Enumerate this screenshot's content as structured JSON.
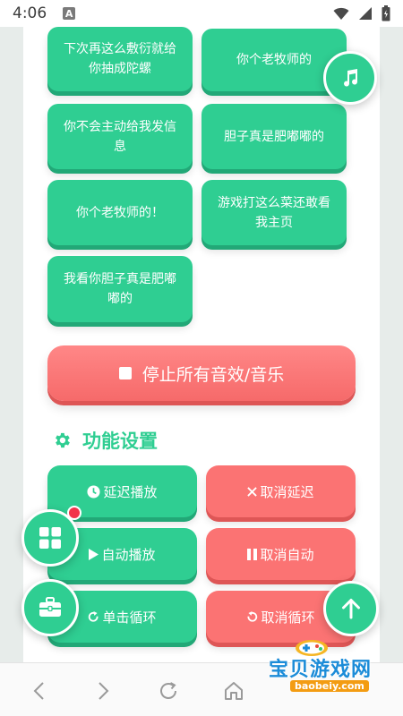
{
  "status_bar": {
    "time": "4:06",
    "sim_label": "A"
  },
  "sound_buttons": [
    {
      "label": "下次再这么敷衍就给你抽成陀螺"
    },
    {
      "label": "你个老牧师的"
    },
    {
      "label": "你不会主动给我发信息"
    },
    {
      "label": "胆子真是肥嘟嘟的"
    },
    {
      "label": "你个老牧师的！"
    },
    {
      "label": "游戏打这么菜还敢看我主页"
    },
    {
      "label": "我看你胆子真是肥嘟嘟的"
    }
  ],
  "stop_button": {
    "label": "停止所有音效/音乐"
  },
  "settings": {
    "title": "功能设置",
    "buttons": [
      {
        "label": "延迟播放",
        "icon": "clock-icon",
        "color": "#2fce92"
      },
      {
        "label": "取消延迟",
        "icon": "x-icon",
        "color": "#fb7373"
      },
      {
        "label": "自动播放",
        "icon": "play-icon",
        "color": "#2fce92"
      },
      {
        "label": "取消自动",
        "icon": "pause-icon",
        "color": "#fb7373"
      },
      {
        "label": "单击循环",
        "icon": "redo-icon",
        "color": "#2fce92"
      },
      {
        "label": "取消循环",
        "icon": "undo-icon",
        "color": "#fb7373"
      }
    ]
  },
  "floating": {
    "music_icon": "music-note-icon",
    "grid_icon": "grid-icon",
    "toolbox_icon": "toolbox-icon",
    "top_icon": "arrow-up-icon"
  },
  "watermark": {
    "title": "宝贝游戏网",
    "url": "baobeiy.com"
  },
  "colors": {
    "accent_green": "#2fce92",
    "accent_red": "#fb7373"
  }
}
